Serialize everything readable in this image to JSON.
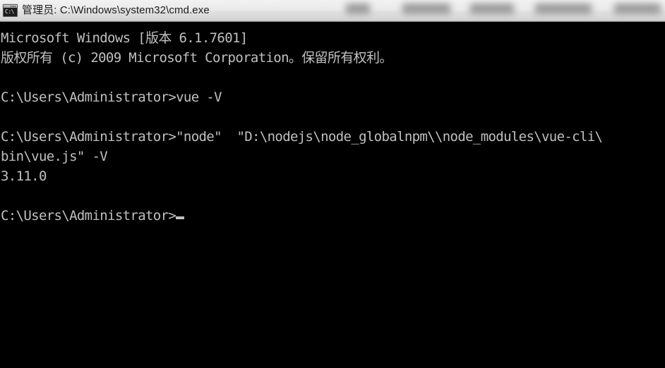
{
  "window": {
    "title": "管理员: C:\\Windows\\system32\\cmd.exe",
    "icon_label": "C:\\",
    "icon_name": "cmd-console-icon",
    "background_color": "#000000",
    "text_color": "#c0c0c0",
    "titlebar_color": "#e6e6e6"
  },
  "console": {
    "lines": [
      {
        "text": "Microsoft Windows [版本 6.1.7601]",
        "kind": "banner"
      },
      {
        "text": "版权所有 (c) 2009 Microsoft Corporation。保留所有权利。",
        "kind": "banner"
      },
      {
        "text": "",
        "kind": "blank"
      },
      {
        "text": "C:\\Users\\Administrator>vue -V",
        "kind": "prompt-command"
      },
      {
        "text": "",
        "kind": "blank"
      },
      {
        "text": "C:\\Users\\Administrator>\"node\"  \"D:\\nodejs\\node_globalnpm\\\\node_modules\\vue-cli\\",
        "kind": "prompt-command"
      },
      {
        "text": "bin\\vue.js\" -V",
        "kind": "wrapped-command"
      },
      {
        "text": "3.11.0",
        "kind": "output"
      },
      {
        "text": "",
        "kind": "blank"
      },
      {
        "text": "C:\\Users\\Administrator>",
        "kind": "prompt",
        "cursor": true
      }
    ]
  }
}
